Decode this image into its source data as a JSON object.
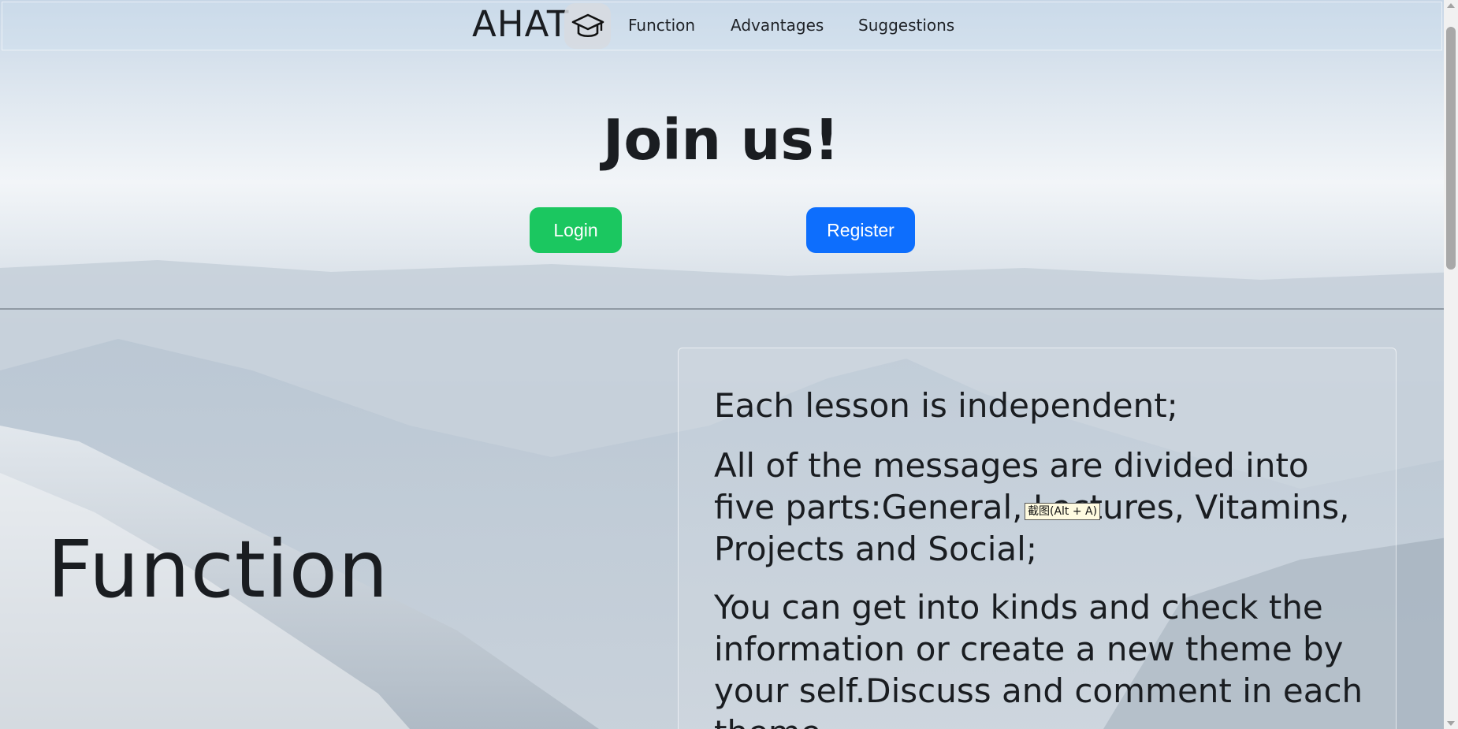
{
  "brand": {
    "name": "AHAT",
    "icon": "graduation-cap-icon"
  },
  "nav": {
    "items": [
      "Function",
      "Advantages",
      "Suggestions"
    ]
  },
  "hero": {
    "title": "Join us!",
    "login_label": "Login",
    "register_label": "Register"
  },
  "function_section": {
    "title": "Function",
    "paragraphs": [
      "Each lesson is independent;",
      "All of the messages are divided into five parts:General, Lectures, Vitamins, Projects and Social;",
      "You can get into kinds and check the information or create a new theme by your self.Discuss and comment in each theme."
    ]
  },
  "tooltip": "截图(Alt + A)",
  "colors": {
    "login": "#1bc760",
    "register": "#0d6efd"
  }
}
